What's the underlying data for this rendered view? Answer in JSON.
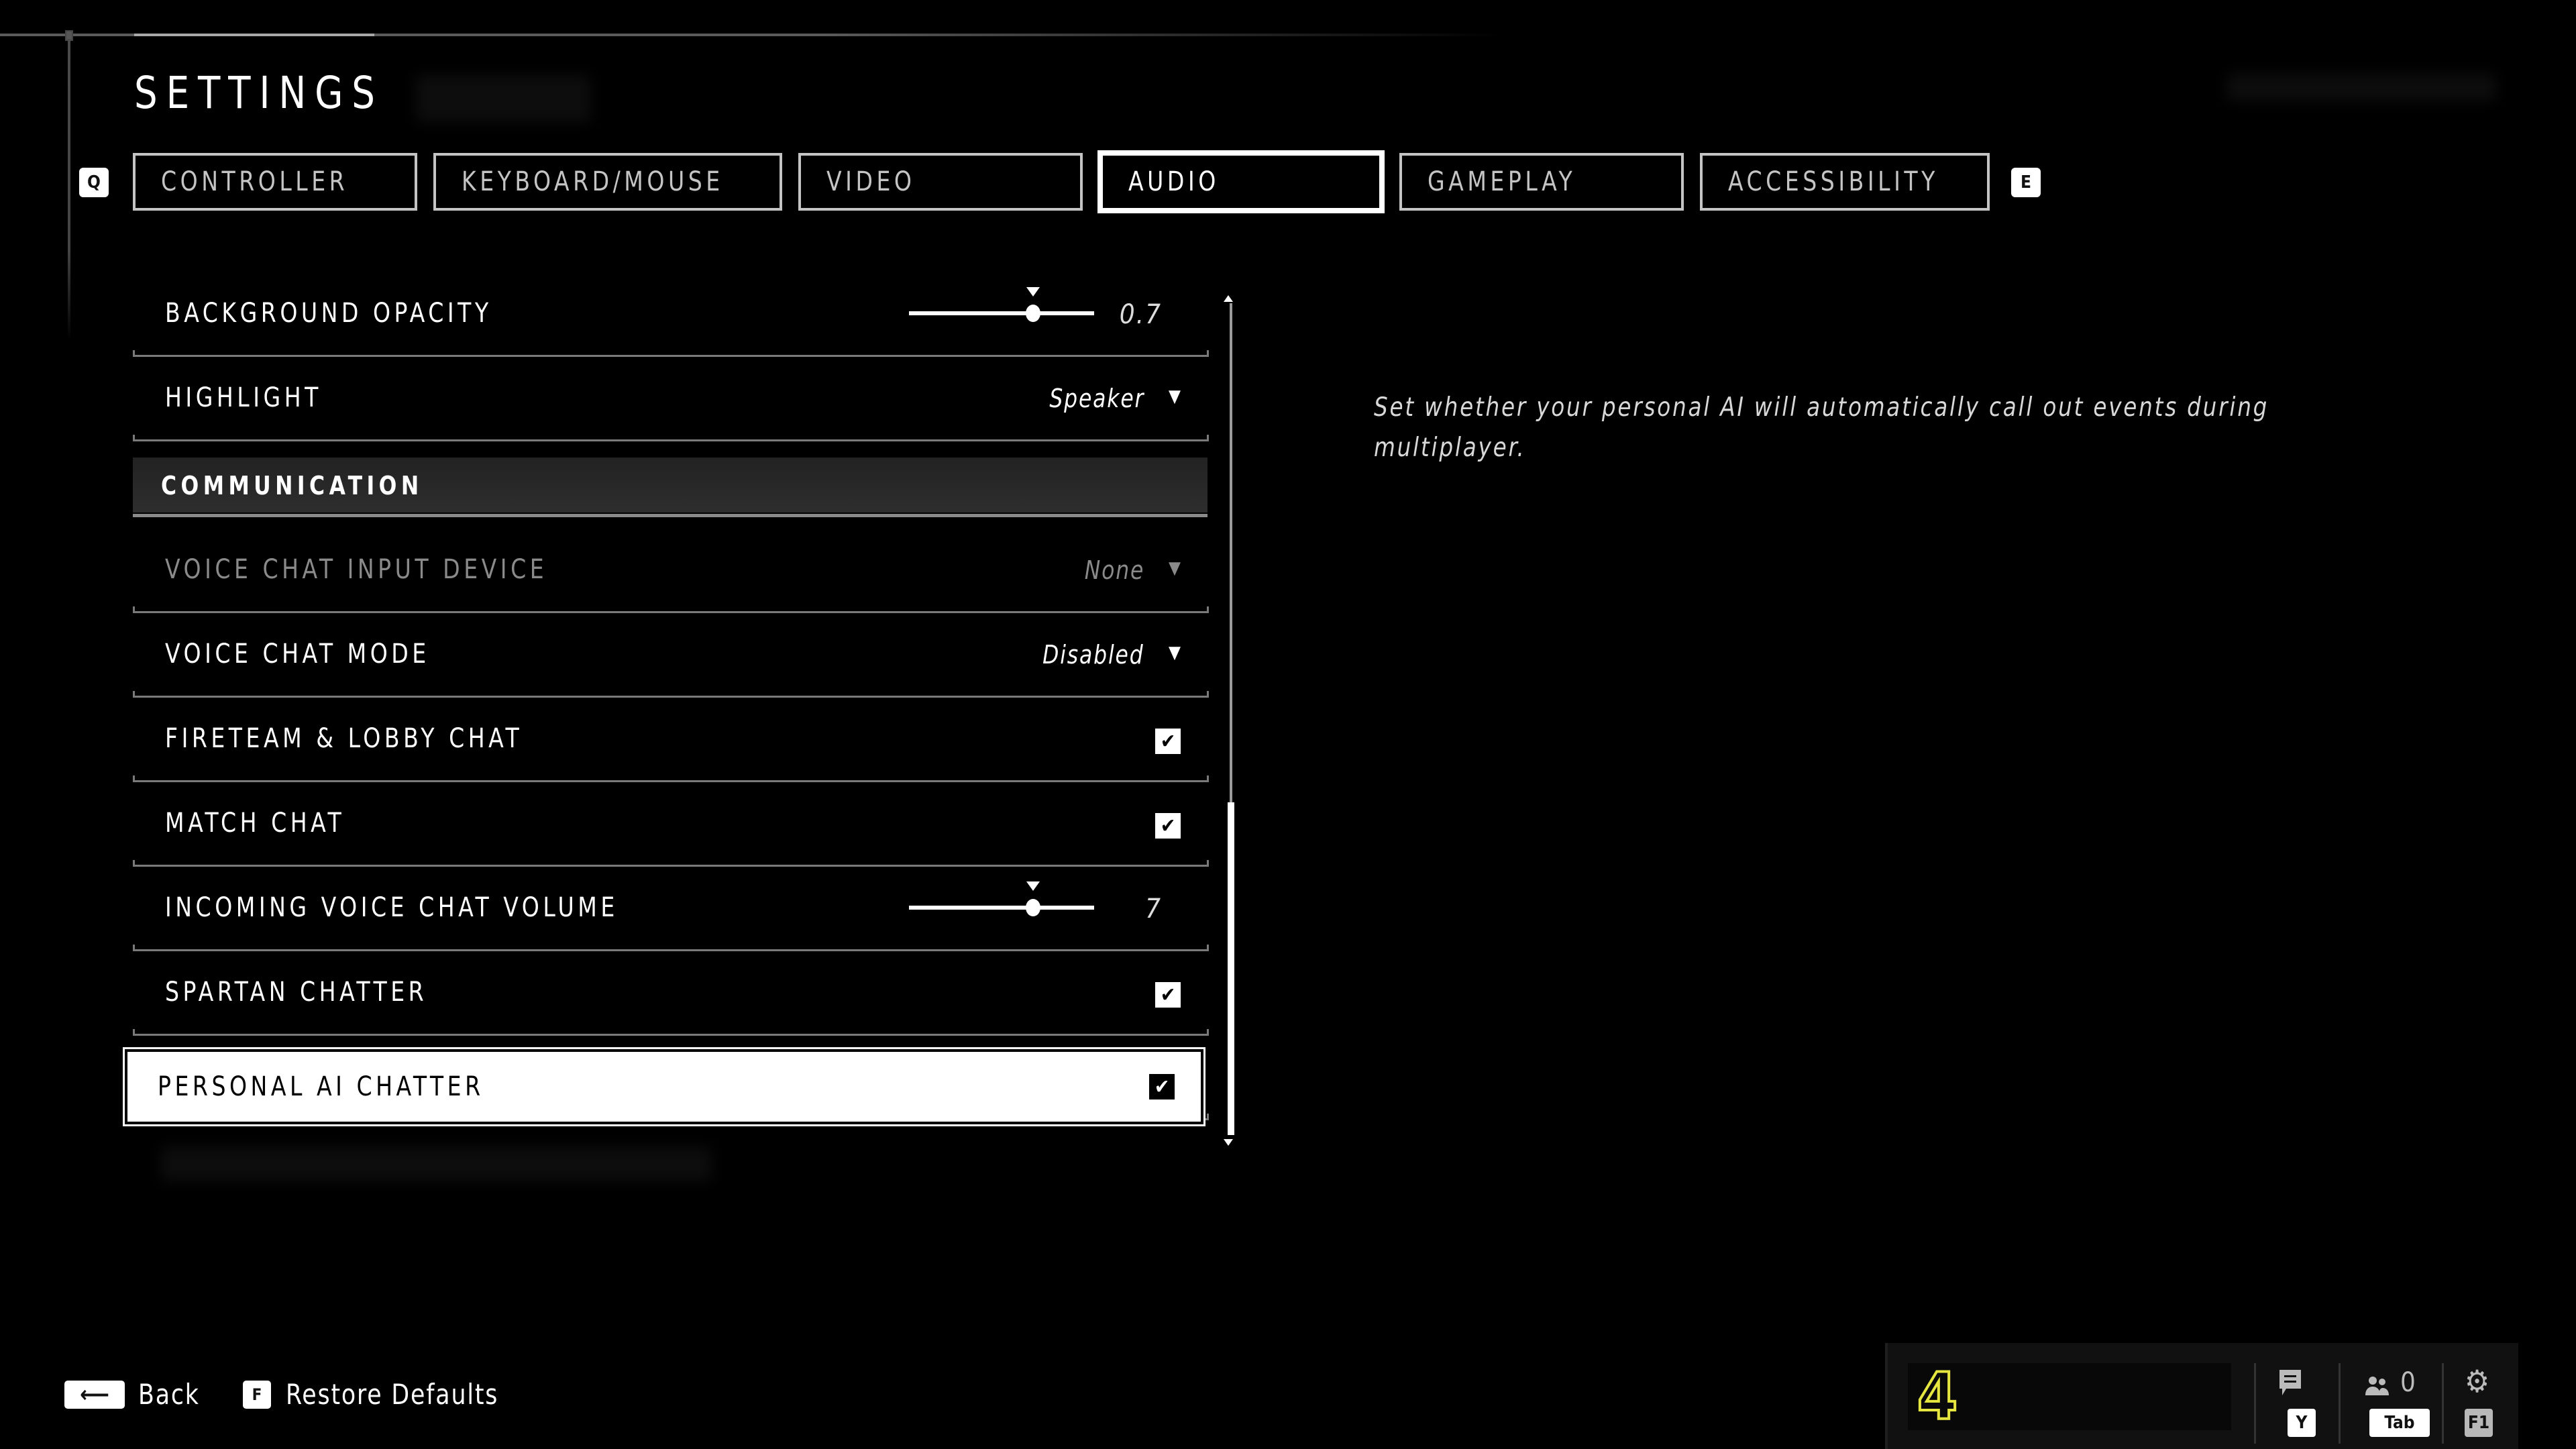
{
  "header": {
    "title": "SETTINGS",
    "prev_tab_key": "Q",
    "next_tab_key": "E"
  },
  "tabs": [
    {
      "label": "CONTROLLER",
      "active": false
    },
    {
      "label": "KEYBOARD/MOUSE",
      "active": false
    },
    {
      "label": "VIDEO",
      "active": false
    },
    {
      "label": "AUDIO",
      "active": true
    },
    {
      "label": "GAMEPLAY",
      "active": false
    },
    {
      "label": "ACCESSIBILITY",
      "active": false
    }
  ],
  "settings": {
    "background_opacity": {
      "label": "BACKGROUND OPACITY",
      "type": "slider",
      "value": "0.7",
      "range": [
        0,
        1
      ]
    },
    "highlight": {
      "label": "HIGHLIGHT",
      "type": "dropdown",
      "value": "Speaker"
    },
    "section_communication": {
      "label": "COMMUNICATION"
    },
    "voice_chat_input_device": {
      "label": "VOICE CHAT INPUT DEVICE",
      "type": "dropdown",
      "value": "None",
      "disabled": true
    },
    "voice_chat_mode": {
      "label": "VOICE CHAT MODE",
      "type": "dropdown",
      "value": "Disabled"
    },
    "fireteam_lobby_chat": {
      "label": "FIRETEAM & LOBBY CHAT",
      "type": "checkbox",
      "checked": true,
      "glyph": "✔"
    },
    "match_chat": {
      "label": "MATCH CHAT",
      "type": "checkbox",
      "checked": true,
      "glyph": "✔"
    },
    "incoming_voice_chat_volume": {
      "label": "INCOMING VOICE CHAT VOLUME",
      "type": "slider",
      "value": "7",
      "range": [
        0,
        10
      ]
    },
    "spartan_chatter": {
      "label": "SPARTAN CHATTER",
      "type": "checkbox",
      "checked": true,
      "glyph": "✔"
    },
    "personal_ai_chatter": {
      "label": "PERSONAL AI CHATTER",
      "type": "checkbox",
      "checked": true,
      "selected": true,
      "glyph": "✔"
    }
  },
  "slider_thumb_fraction": 0.67,
  "scroll": {
    "position_fraction": 0.6,
    "visible_fraction": 0.4
  },
  "description": "Set whether your personal AI will automatically call out events during multiplayer.",
  "footer": {
    "back": {
      "key": "⟵",
      "label": "Back"
    },
    "restore": {
      "key": "F",
      "label": "Restore Defaults"
    }
  },
  "hud": {
    "rank": "4",
    "rank_color": "#e6e640",
    "chat": {
      "icon": "chat-icon",
      "key": "Y"
    },
    "social": {
      "icon": "people-icon",
      "count": "0",
      "key": "Tab"
    },
    "settings": {
      "icon": "gear-icon",
      "glyph": "⚙",
      "key": "F1"
    }
  }
}
